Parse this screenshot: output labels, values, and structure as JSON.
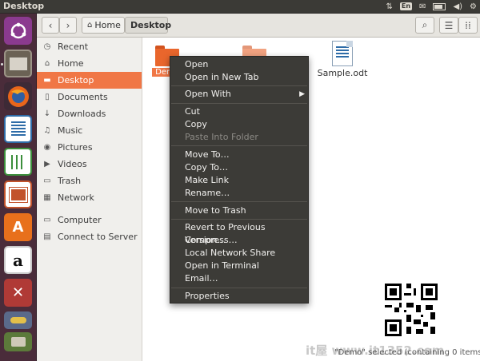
{
  "window": {
    "title": "Desktop"
  },
  "tray": {
    "language": "En"
  },
  "toolbar": {
    "breadcrumb": [
      {
        "label": "Home"
      },
      {
        "label": "Desktop"
      }
    ]
  },
  "sidebar": {
    "items": [
      {
        "label": "Recent",
        "icon": "clock-icon"
      },
      {
        "label": "Home",
        "icon": "home-icon"
      },
      {
        "label": "Desktop",
        "icon": "folder-icon",
        "active": true
      },
      {
        "label": "Documents",
        "icon": "document-icon"
      },
      {
        "label": "Downloads",
        "icon": "download-icon"
      },
      {
        "label": "Music",
        "icon": "music-icon"
      },
      {
        "label": "Pictures",
        "icon": "camera-icon"
      },
      {
        "label": "Videos",
        "icon": "film-icon"
      },
      {
        "label": "Trash",
        "icon": "trash-icon"
      },
      {
        "label": "Network",
        "icon": "network-icon"
      },
      {
        "label": "Computer",
        "icon": "computer-icon"
      },
      {
        "label": "Connect to Server",
        "icon": "server-icon"
      }
    ]
  },
  "files": [
    {
      "name": "Demo",
      "type": "folder",
      "selected": true
    },
    {
      "name": "",
      "type": "folder"
    },
    {
      "name": "Sample.odt",
      "type": "document"
    }
  ],
  "context_menu": {
    "items": [
      {
        "label": "Open"
      },
      {
        "label": "Open in New Tab"
      },
      {
        "label": "Open With",
        "submenu": true
      },
      {
        "label": "Cut"
      },
      {
        "label": "Copy"
      },
      {
        "label": "Paste Into Folder",
        "disabled": true
      },
      {
        "label": "Move To…"
      },
      {
        "label": "Copy To…"
      },
      {
        "label": "Make Link"
      },
      {
        "label": "Rename…"
      },
      {
        "label": "Move to Trash"
      },
      {
        "label": "Revert to Previous Version…"
      },
      {
        "label": "Compress…"
      },
      {
        "label": "Local Network Share"
      },
      {
        "label": "Open in Terminal"
      },
      {
        "label": "Email…"
      },
      {
        "label": "Properties"
      }
    ]
  },
  "status": {
    "text": "\"Demo\" selected (containing 0 items)"
  },
  "watermark": {
    "text": "it屋 www.it1352.com"
  },
  "colors": {
    "accent": "#f07746",
    "launcher": "#4a2c3a",
    "menu": "#3c3b37"
  }
}
